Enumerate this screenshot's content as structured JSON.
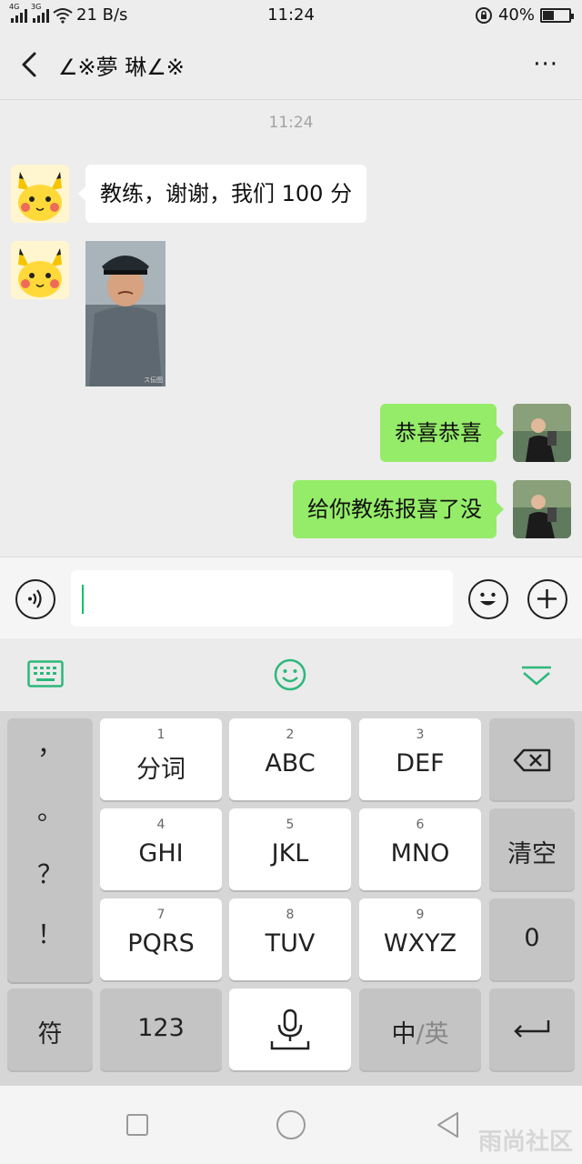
{
  "status_bar": {
    "network_1": "4G",
    "network_2": "3G",
    "speed": "21 B/s",
    "time": "11:24",
    "battery": "40%"
  },
  "header": {
    "title": "∠※夢 琳∠※",
    "more_label": "···"
  },
  "chat": {
    "timestamp": "11:24",
    "messages": [
      {
        "side": "in",
        "type": "text",
        "text": "教练，谢谢，我们 100 分"
      },
      {
        "side": "in",
        "type": "image",
        "caption": "ス伝图"
      },
      {
        "side": "out",
        "type": "text",
        "text": "恭喜恭喜"
      },
      {
        "side": "out",
        "type": "text",
        "text": "给你教练报喜了没"
      }
    ]
  },
  "input": {
    "value": ""
  },
  "keyboard": {
    "punctuation": [
      "，",
      "。",
      "？",
      "！"
    ],
    "keys": [
      {
        "num": "1",
        "label": "分词"
      },
      {
        "num": "2",
        "label": "ABC"
      },
      {
        "num": "3",
        "label": "DEF"
      },
      {
        "num": "4",
        "label": "GHI"
      },
      {
        "num": "5",
        "label": "JKL"
      },
      {
        "num": "6",
        "label": "MNO"
      },
      {
        "num": "7",
        "label": "PQRS"
      },
      {
        "num": "8",
        "label": "TUV"
      },
      {
        "num": "9",
        "label": "WXYZ"
      }
    ],
    "clear_label": "清空",
    "zero_label": "0",
    "symbol_label": "符",
    "numeric_label": "123",
    "lang_zh": "中",
    "lang_sep": "/",
    "lang_en": "英"
  },
  "watermark": "雨尚社区",
  "colors": {
    "accent": "#07c160",
    "outgoing_bubble": "#95ec69",
    "incoming_bubble": "#ffffff"
  }
}
